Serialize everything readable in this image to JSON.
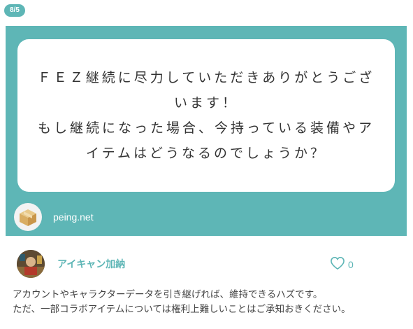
{
  "date_badge": "8/5",
  "question": {
    "lines": [
      "ＦＥＺ継続に尽力していただきありがとうござ",
      "います！",
      "もし継続になった場合、今持っている装備やア",
      "イテムはどうなるのでしょうか？"
    ]
  },
  "brand": {
    "name": "peing.net",
    "logo_icon": "box-icon"
  },
  "author": {
    "name": "アイキャン加納",
    "avatar_icon": "user-avatar"
  },
  "like": {
    "count": "0",
    "icon": "heart-icon"
  },
  "answer": {
    "lines": [
      "アカウントやキャラクターデータを引き継げれば、維持できるハズです。",
      "ただ、一部コラボアイテムについては権利上難しいことはご承知おきください。"
    ]
  },
  "colors": {
    "accent": "#5eb6b6",
    "text": "#444444",
    "card_bg": "#5eb6b6"
  }
}
